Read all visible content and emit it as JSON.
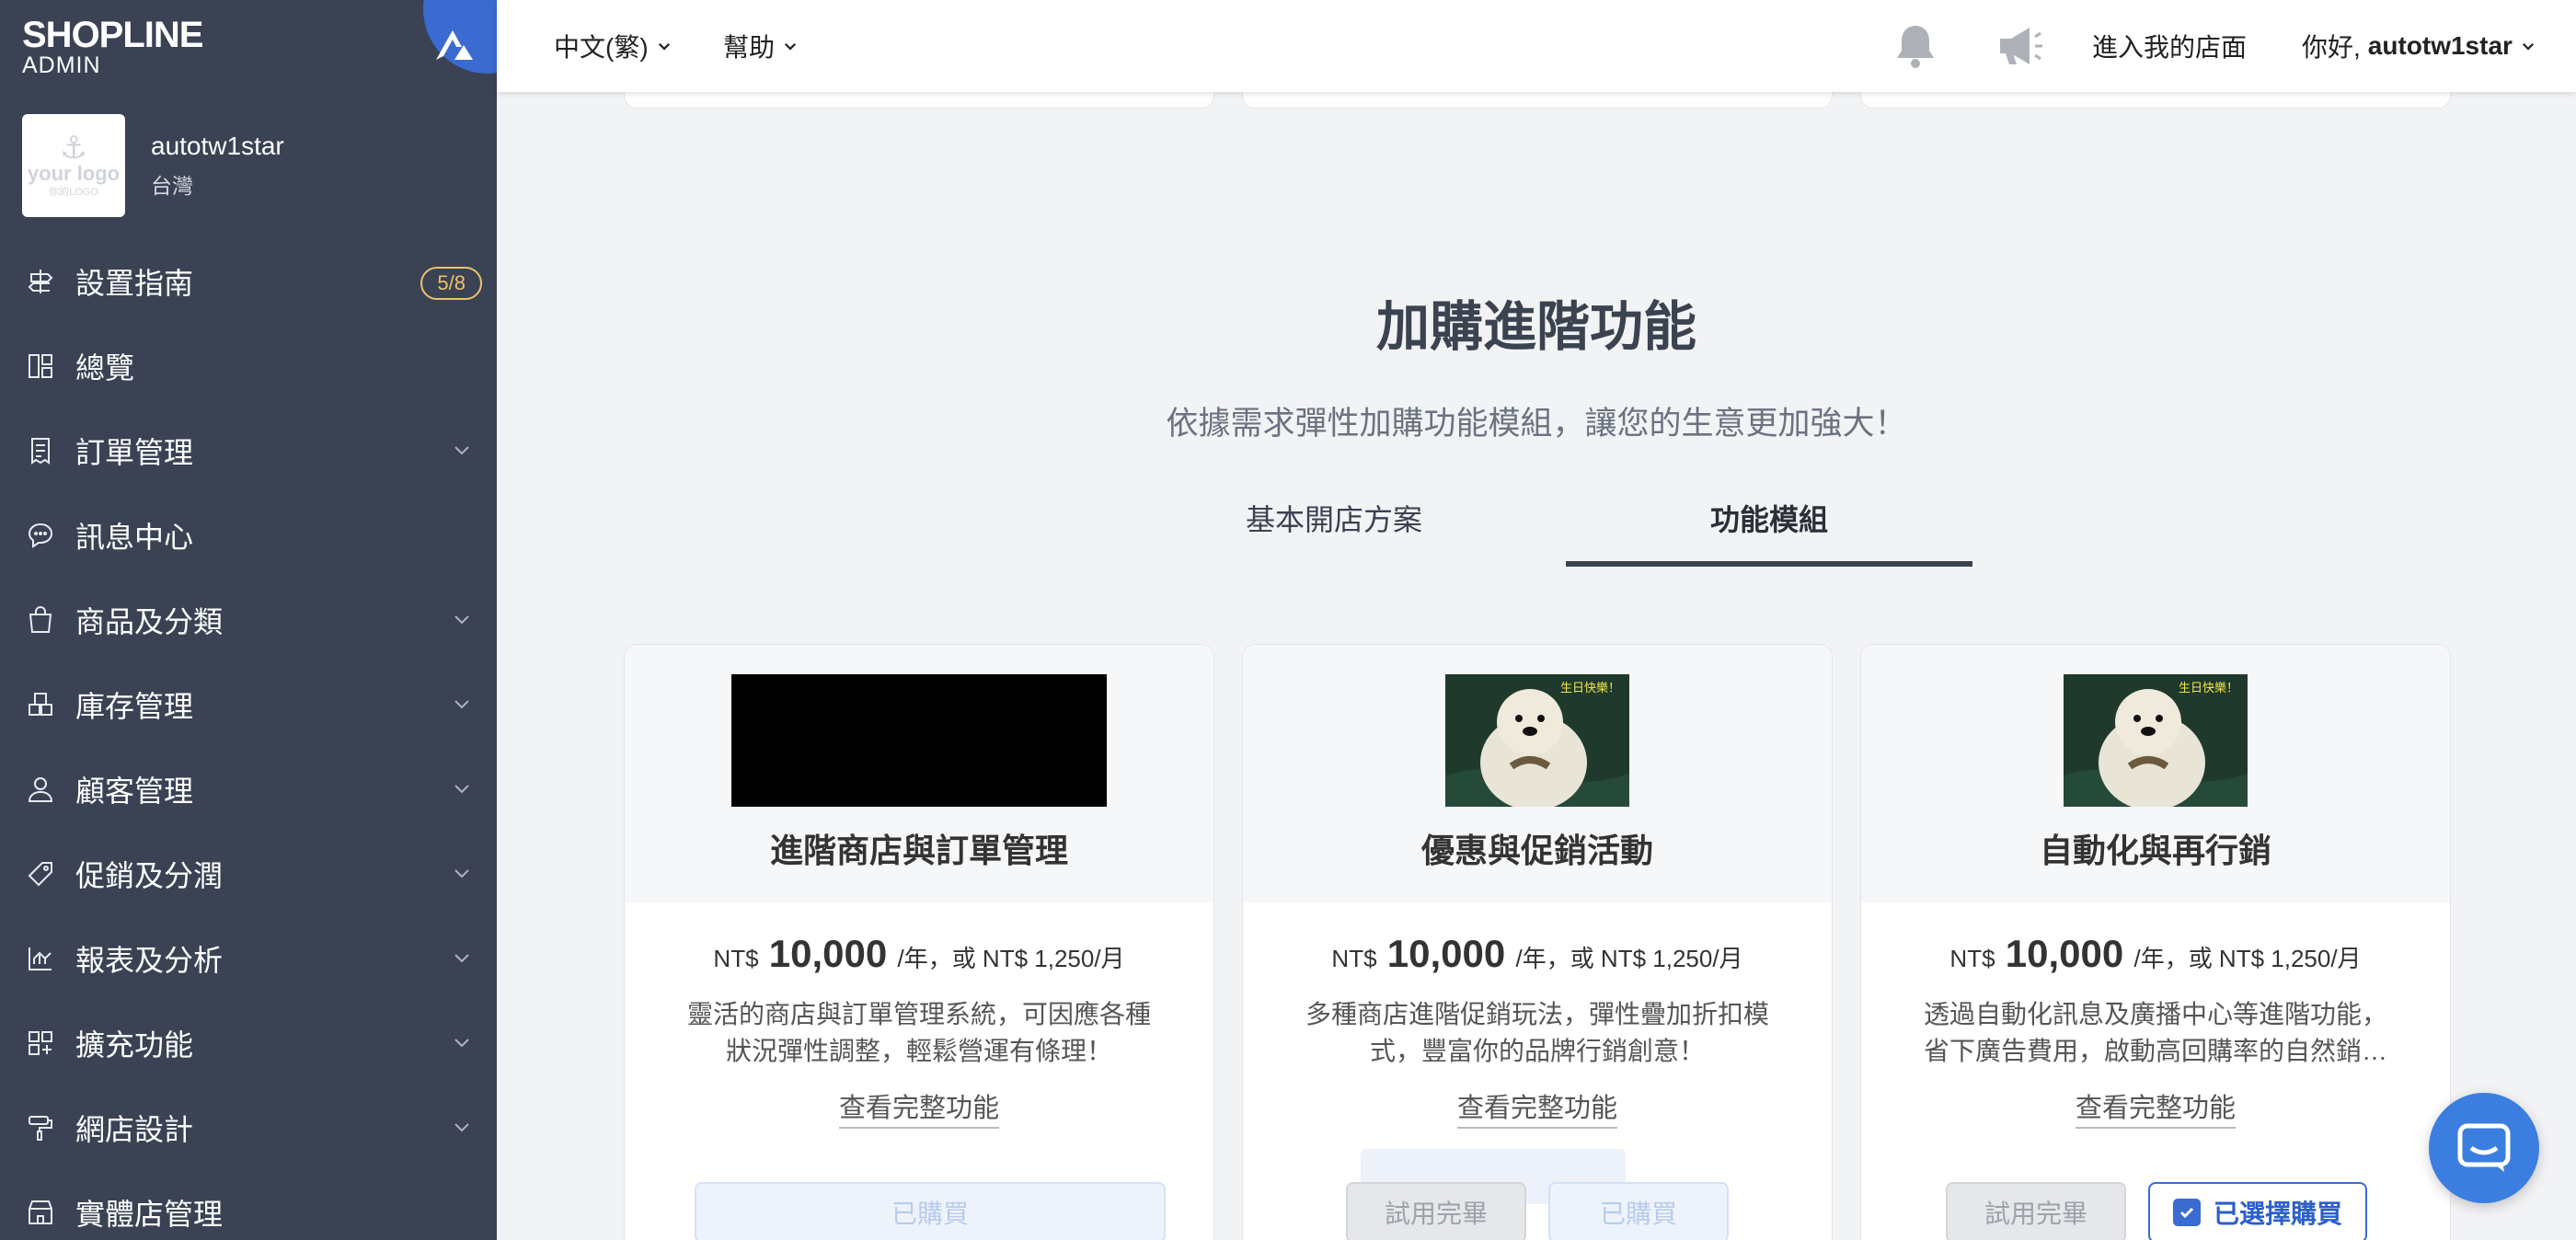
{
  "brand": {
    "name": "SHOPLINE",
    "sub": "ADMIN"
  },
  "store": {
    "logo_text": "your logo",
    "logo_sub": "你的LOGO",
    "name": "autotw1star",
    "region": "台灣"
  },
  "sidebar": {
    "items": [
      {
        "label": "設置指南",
        "badge": "5/8"
      },
      {
        "label": "總覽"
      },
      {
        "label": "訂單管理"
      },
      {
        "label": "訊息中心"
      },
      {
        "label": "商品及分類"
      },
      {
        "label": "庫存管理"
      },
      {
        "label": "顧客管理"
      },
      {
        "label": "促銷及分潤"
      },
      {
        "label": "報表及分析"
      },
      {
        "label": "擴充功能"
      },
      {
        "label": "網店設計"
      },
      {
        "label": "實體店管理"
      }
    ]
  },
  "topbar": {
    "language": "中文(繁)",
    "help": "幫助",
    "visit_store": "進入我的店面",
    "greeting": "你好,",
    "user": "autotw1star"
  },
  "section": {
    "title": "加購進階功能",
    "subtitle": "依據需求彈性加購功能模組，讓您的生意更加強大！"
  },
  "tabs": [
    {
      "label": "基本開店方案"
    },
    {
      "label": "功能模組"
    }
  ],
  "cards": [
    {
      "title": "進階商店與訂單管理",
      "currency": "NT$",
      "amount": "10,000",
      "suffix": "/年，或 NT$ 1,250/月",
      "desc1": "靈活的商店與訂單管理系統，可因應各種",
      "desc2": "狀況彈性調整，輕鬆營運有條理！",
      "more": "查看完整功能",
      "btn_purchased": "已購買"
    },
    {
      "title": "優惠與促銷活動",
      "currency": "NT$",
      "amount": "10,000",
      "suffix": "/年，或 NT$ 1,250/月",
      "image_caption": "生日快樂！",
      "desc1": "多種商店進階促銷玩法，彈性疊加折扣模",
      "desc2": "式，豐富你的品牌行銷創意！",
      "more": "查看完整功能",
      "btn_trial": "試用完畢",
      "btn_purchased": "已購買"
    },
    {
      "title": "自動化與再行銷",
      "currency": "NT$",
      "amount": "10,000",
      "suffix": "/年，或 NT$ 1,250/月",
      "image_caption": "生日快樂！",
      "desc1": "透過自動化訊息及廣播中心等進階功能，",
      "desc2": "省下廣告費用，啟動高回購率的自然銷…",
      "more": "查看完整功能",
      "btn_trial": "試用完畢",
      "btn_selected": "已選擇購買"
    }
  ],
  "colors": {
    "sidebar": "#3a4254",
    "accent": "#3b6bd0",
    "badge": "#e9c36c"
  }
}
